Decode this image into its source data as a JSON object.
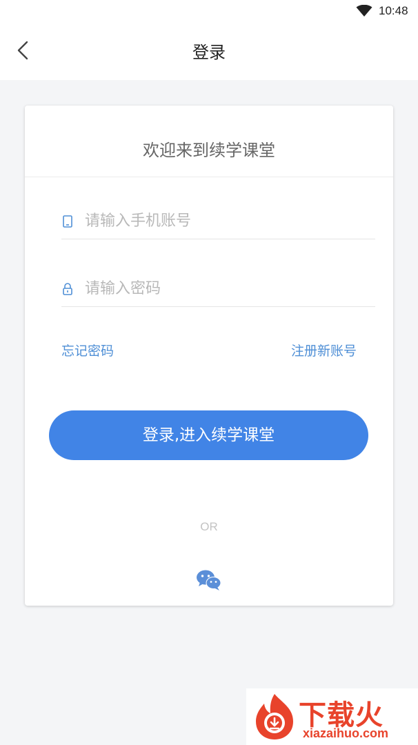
{
  "status_bar": {
    "time": "10:48",
    "wifi_icon": "wifi-icon"
  },
  "header": {
    "back_icon": "chevron-left-icon",
    "title": "登录"
  },
  "card": {
    "welcome": "欢迎来到续学课堂",
    "phone_field": {
      "icon": "phone-icon",
      "placeholder": "请输入手机账号",
      "value": ""
    },
    "password_field": {
      "icon": "lock-icon",
      "placeholder": "请输入密码",
      "value": ""
    },
    "forgot_password": "忘记密码",
    "register": "注册新账号",
    "login_button": "登录,进入续学课堂",
    "or": "OR",
    "wechat_icon": "wechat-icon"
  },
  "watermark": {
    "brand": "下载火",
    "domain": "xiazaihuo.com"
  },
  "colors": {
    "accent": "#4184e6",
    "link": "#4f8fd6",
    "background": "#f4f5f7",
    "watermark": "#e8432b"
  }
}
